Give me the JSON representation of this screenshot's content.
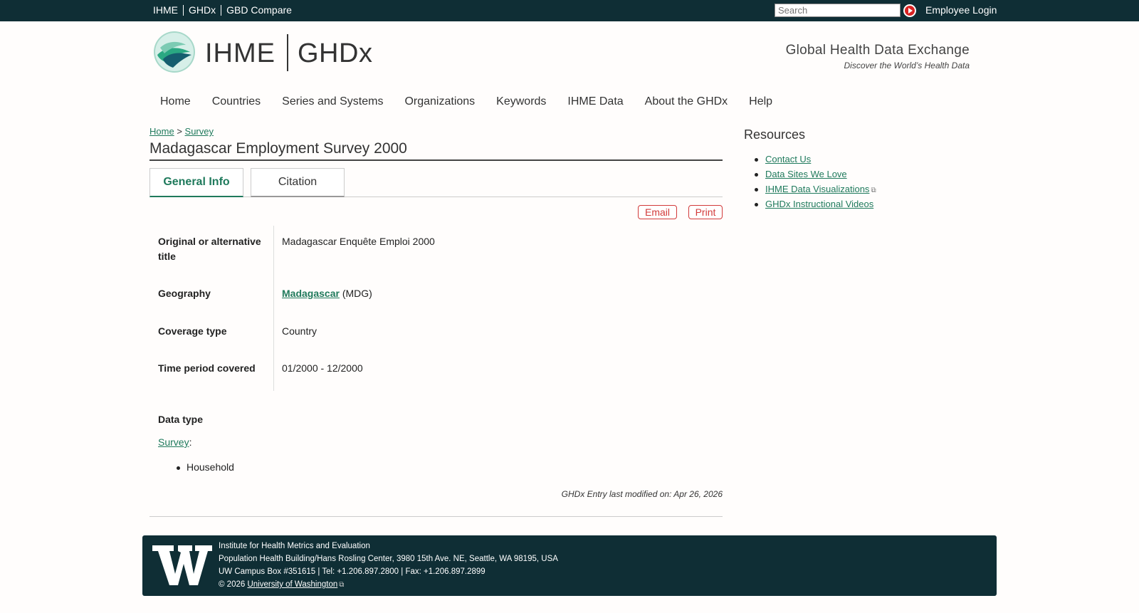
{
  "topbar": {
    "sites": [
      "IHME",
      "GHDx",
      "GBD Compare"
    ],
    "search_placeholder": "Search",
    "login": "Employee Login"
  },
  "branding": {
    "org": "IHME",
    "product": "GHDx",
    "tagline": "Global Health Data Exchange",
    "subtagline": "Discover the World’s Health Data"
  },
  "nav": [
    "Home",
    "Countries",
    "Series and Systems",
    "Organizations",
    "Keywords",
    "IHME Data",
    "About the GHDx",
    "Help"
  ],
  "breadcrumb": {
    "home": "Home",
    "sep": ">",
    "section": "Survey"
  },
  "title": "Madagascar Employment Survey 2000",
  "tabs": {
    "general": "General Info",
    "citation": "Citation"
  },
  "actions": {
    "email": "Email",
    "print": "Print"
  },
  "fields": {
    "alt_title_label": "Original or alternative title",
    "alt_title_value": "Madagascar Enquête Emploi 2000",
    "geography_label": "Geography",
    "geography_link": "Madagascar",
    "geography_code": "(MDG)",
    "coverage_label": "Coverage type",
    "coverage_value": "Country",
    "period_label": "Time period covered",
    "period_value": "01/2000 - 12/2000",
    "datatype_label": "Data type",
    "datatype_link": "Survey",
    "datatype_item": "Household"
  },
  "modified": "GHDx Entry last modified on: Apr 26, 2026",
  "resources": {
    "title": "Resources",
    "items": [
      "Contact Us",
      "Data Sites We Love",
      "IHME Data Visualizations",
      "GHDx Instructional Videos"
    ]
  },
  "footer": {
    "line1": "Institute for Health Metrics and Evaluation",
    "line2": "Population Health Building/Hans Rosling Center, 3980 15th Ave. NE, Seattle, WA 98195, USA",
    "line3": "UW Campus Box #351615 | Tel: +1.206.897.2800 | Fax: +1.206.897.2899",
    "copyright": "© 2026",
    "uw_link": "University of Washington"
  },
  "colors": {
    "topbar": "#0f2e35",
    "link": "#1f7a5c",
    "accent_red": "#d23a3a"
  }
}
